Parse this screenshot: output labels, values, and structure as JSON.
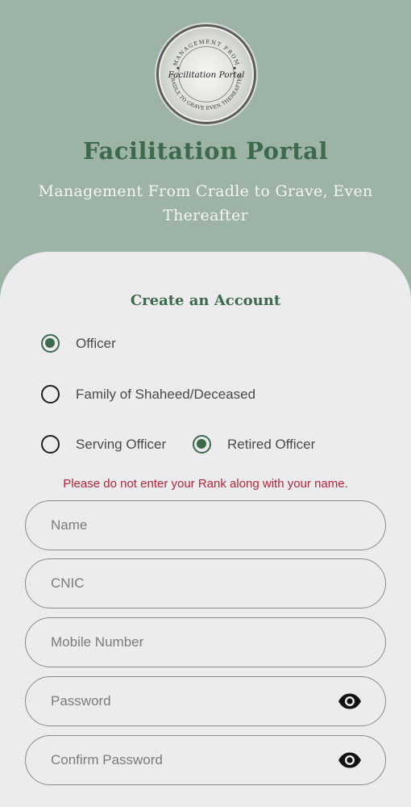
{
  "header": {
    "logo_text_top": "MANAGEMENT FROM",
    "logo_text_center": "Facilitation Portal",
    "logo_text_bottom": "CRADLE TO GRAVE EVEN THEREAFTER",
    "title": "Facilitation Portal",
    "subtitle": "Management From Cradle to Grave, Even Thereafter"
  },
  "form": {
    "title": "Create an Account",
    "account_types": [
      {
        "label": "Officer",
        "checked": true
      },
      {
        "label": "Family of Shaheed/Deceased",
        "checked": false
      }
    ],
    "officer_status": [
      {
        "label": "Serving Officer",
        "checked": false
      },
      {
        "label": "Retired Officer",
        "checked": true
      }
    ],
    "warning": "Please do not enter your Rank along with your name.",
    "fields": {
      "name": {
        "placeholder": "Name",
        "value": ""
      },
      "cnic": {
        "placeholder": "CNIC",
        "value": ""
      },
      "mobile": {
        "placeholder": "Mobile Number",
        "value": ""
      },
      "password": {
        "placeholder": "Password",
        "value": ""
      },
      "confirm_password": {
        "placeholder": "Confirm Password",
        "value": ""
      }
    },
    "icons": {
      "password_toggle": "eye-icon",
      "confirm_toggle": "eye-icon"
    }
  },
  "colors": {
    "header_bg": "#9db3a5",
    "card_bg": "#ececee",
    "accent": "#3c6a4a",
    "warning": "#b3263a"
  }
}
